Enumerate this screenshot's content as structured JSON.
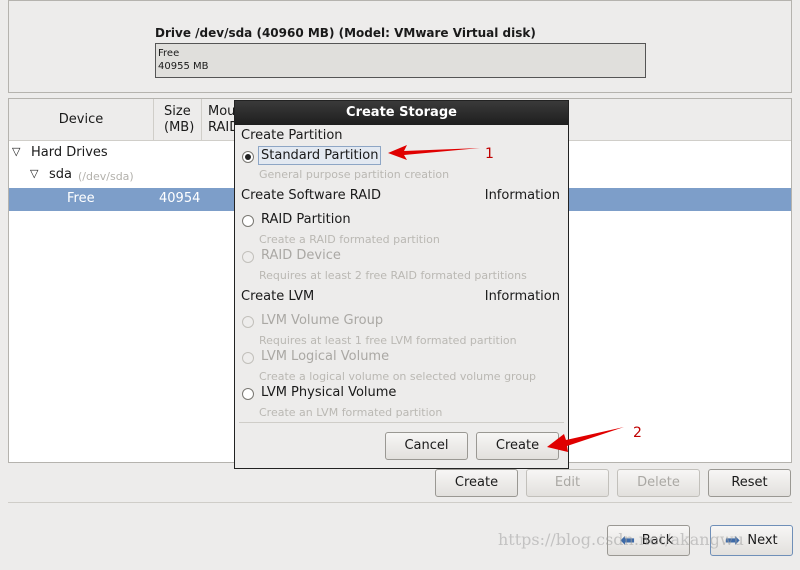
{
  "drive": {
    "title": "Drive /dev/sda (40960 MB) (Model: VMware Virtual disk)",
    "free_label": "Free",
    "free_size": "40955 MB"
  },
  "tree": {
    "columns": [
      "Device",
      "Size\n(MB)",
      "Mount Point/\nRAID/Volume"
    ],
    "col_device": "Device",
    "col_size_1": "Size",
    "col_size_2": "(MB)",
    "col_mount_1": "Mou",
    "col_mount_2": "RAID",
    "rows": [
      {
        "label": "Hard Drives"
      },
      {
        "label": "sda",
        "sub": "(/dev/sda)"
      },
      {
        "label": "Free",
        "size": "40954"
      }
    ]
  },
  "actions": {
    "create": "Create",
    "edit": "Edit",
    "delete": "Delete",
    "reset": "Reset"
  },
  "nav": {
    "back": "Back",
    "next": "Next"
  },
  "dialog": {
    "title": "Create Storage",
    "sec1": "Create Partition",
    "std": "Standard Partition",
    "std_desc": "General purpose partition creation",
    "sec2": "Create Software RAID",
    "info": "Information",
    "raid_part": "RAID Partition",
    "raid_part_desc": "Create a RAID formated partition",
    "raid_dev": "RAID Device",
    "raid_dev_desc": "Requires at least 2 free RAID formated partitions",
    "sec3": "Create LVM",
    "lvm_vg": "LVM Volume Group",
    "lvm_vg_desc": "Requires at least 1 free LVM formated partition",
    "lvm_lv": "LVM Logical Volume",
    "lvm_lv_desc": "Create a logical volume on selected volume group",
    "lvm_pv": "LVM Physical Volume",
    "lvm_pv_desc": "Create an LVM formated partition",
    "cancel": "Cancel",
    "create": "Create",
    "selected": "Standard Partition"
  },
  "annotations": {
    "a1": "1",
    "a2": "2",
    "color": "#e00000"
  },
  "watermark": "https://blog.csdn.net/akangwu",
  "colors": {
    "selection": "#7d9ec9",
    "titlebar": "#2b2b2b"
  }
}
